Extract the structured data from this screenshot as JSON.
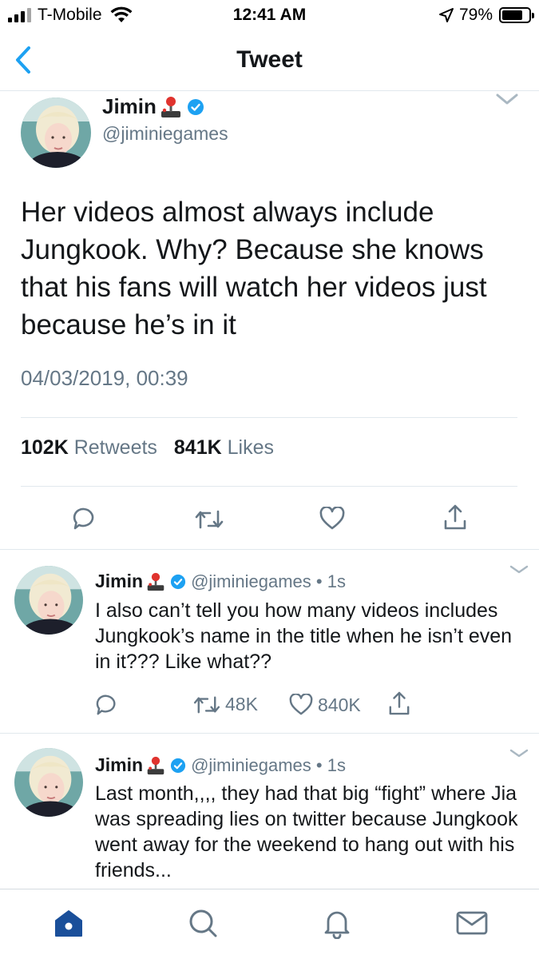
{
  "status_bar": {
    "carrier": "T-Mobile",
    "time": "12:41 AM",
    "battery": "79%",
    "battery_level": 0.79,
    "icons": [
      "signal-icon",
      "wifi-icon",
      "location-arrow-icon",
      "battery-icon"
    ]
  },
  "nav": {
    "title": "Tweet",
    "back_icon": "chevron-left-icon"
  },
  "main_tweet": {
    "author_name": "Jimin",
    "handle": "@jiminiegames",
    "text": "Her videos almost always include Jungkook. Why? Because she knows that his fans will watch her videos just because he’s in it",
    "timestamp": "04/03/2019, 00:39",
    "retweets_count": "102K",
    "retweets_label": "Retweets",
    "likes_count": "841K",
    "likes_label": "Likes",
    "actions": [
      "reply-icon",
      "retweet-icon",
      "heart-icon",
      "share-icon"
    ]
  },
  "replies": [
    {
      "author_name": "Jimin",
      "handle_time": "@jiminiegames • 1s",
      "text": "I also can’t tell you how many videos includes Jungkook’s name in the title when he isn’t even in it??? Like what??",
      "retweets": "48K",
      "likes": "840K"
    },
    {
      "author_name": "Jimin",
      "handle_time": "@jiminiegames • 1s",
      "text": "Last month,,,, they had that big “fight” where Jia was spreading lies on twitter because Jungkook went away for the weekend to hang out with his friends..."
    }
  ],
  "tab_bar": {
    "tabs": [
      "home-icon",
      "search-icon",
      "notifications-bell-icon",
      "messages-envelope-icon"
    ]
  },
  "colors": {
    "accent": "#1da1f2",
    "secondary_text": "#657786",
    "divider": "#e1e8ed",
    "home_active": "#1a4f9a"
  }
}
